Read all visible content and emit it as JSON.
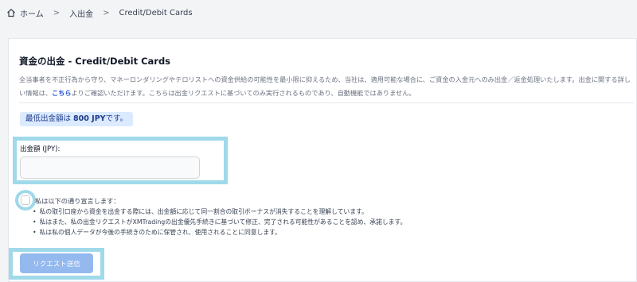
{
  "breadcrumb": {
    "home": "ホーム",
    "deposit_withdraw": "入出金",
    "current": "Credit/Debit Cards",
    "separator": ">"
  },
  "page": {
    "title": "資金の出金 - Credit/Debit Cards",
    "description_part1": "全当事者を不正行為から守り、マネーロンダリングやテロリストへの資金供給の可能性を最小限に抑えるため、当社は、適用可能な場合に、ご資金の入金元へのみ出金／返金処理いたします。出金に関する詳しい情報は、",
    "description_link": "こちら",
    "description_part2": "よりご確認いただけます。こちらは出金リクエストに基づいてのみ実行されるものであり、自動機能ではありません。"
  },
  "min_withdrawal": {
    "prefix": "最低出金額は",
    "amount": "800 JPY",
    "suffix": "です。"
  },
  "amount_field": {
    "label": "出金額 (JPY):",
    "value": "",
    "placeholder": ""
  },
  "declaration": {
    "checked": false,
    "title": "私は以下の通り宣言します：",
    "items": [
      "私の取引口座から資金を出金する際には、出金額に応じて同一割合の取引ボーナスが消失することを理解しています。",
      "私はまた、私の出金リクエストがXMTradingの出金優先手続きに基づいて修正、完了される可能性があることを認め、承諾します。",
      "私は私の個人データが今後の手続きのために保管され、使用されることに同意します。"
    ]
  },
  "submit": {
    "label": "リクエスト送信"
  },
  "colors": {
    "highlight": "#9fd9ea",
    "badge_bg": "#dbeafe",
    "link": "#1d4ed8",
    "button": "#93b9ef"
  }
}
